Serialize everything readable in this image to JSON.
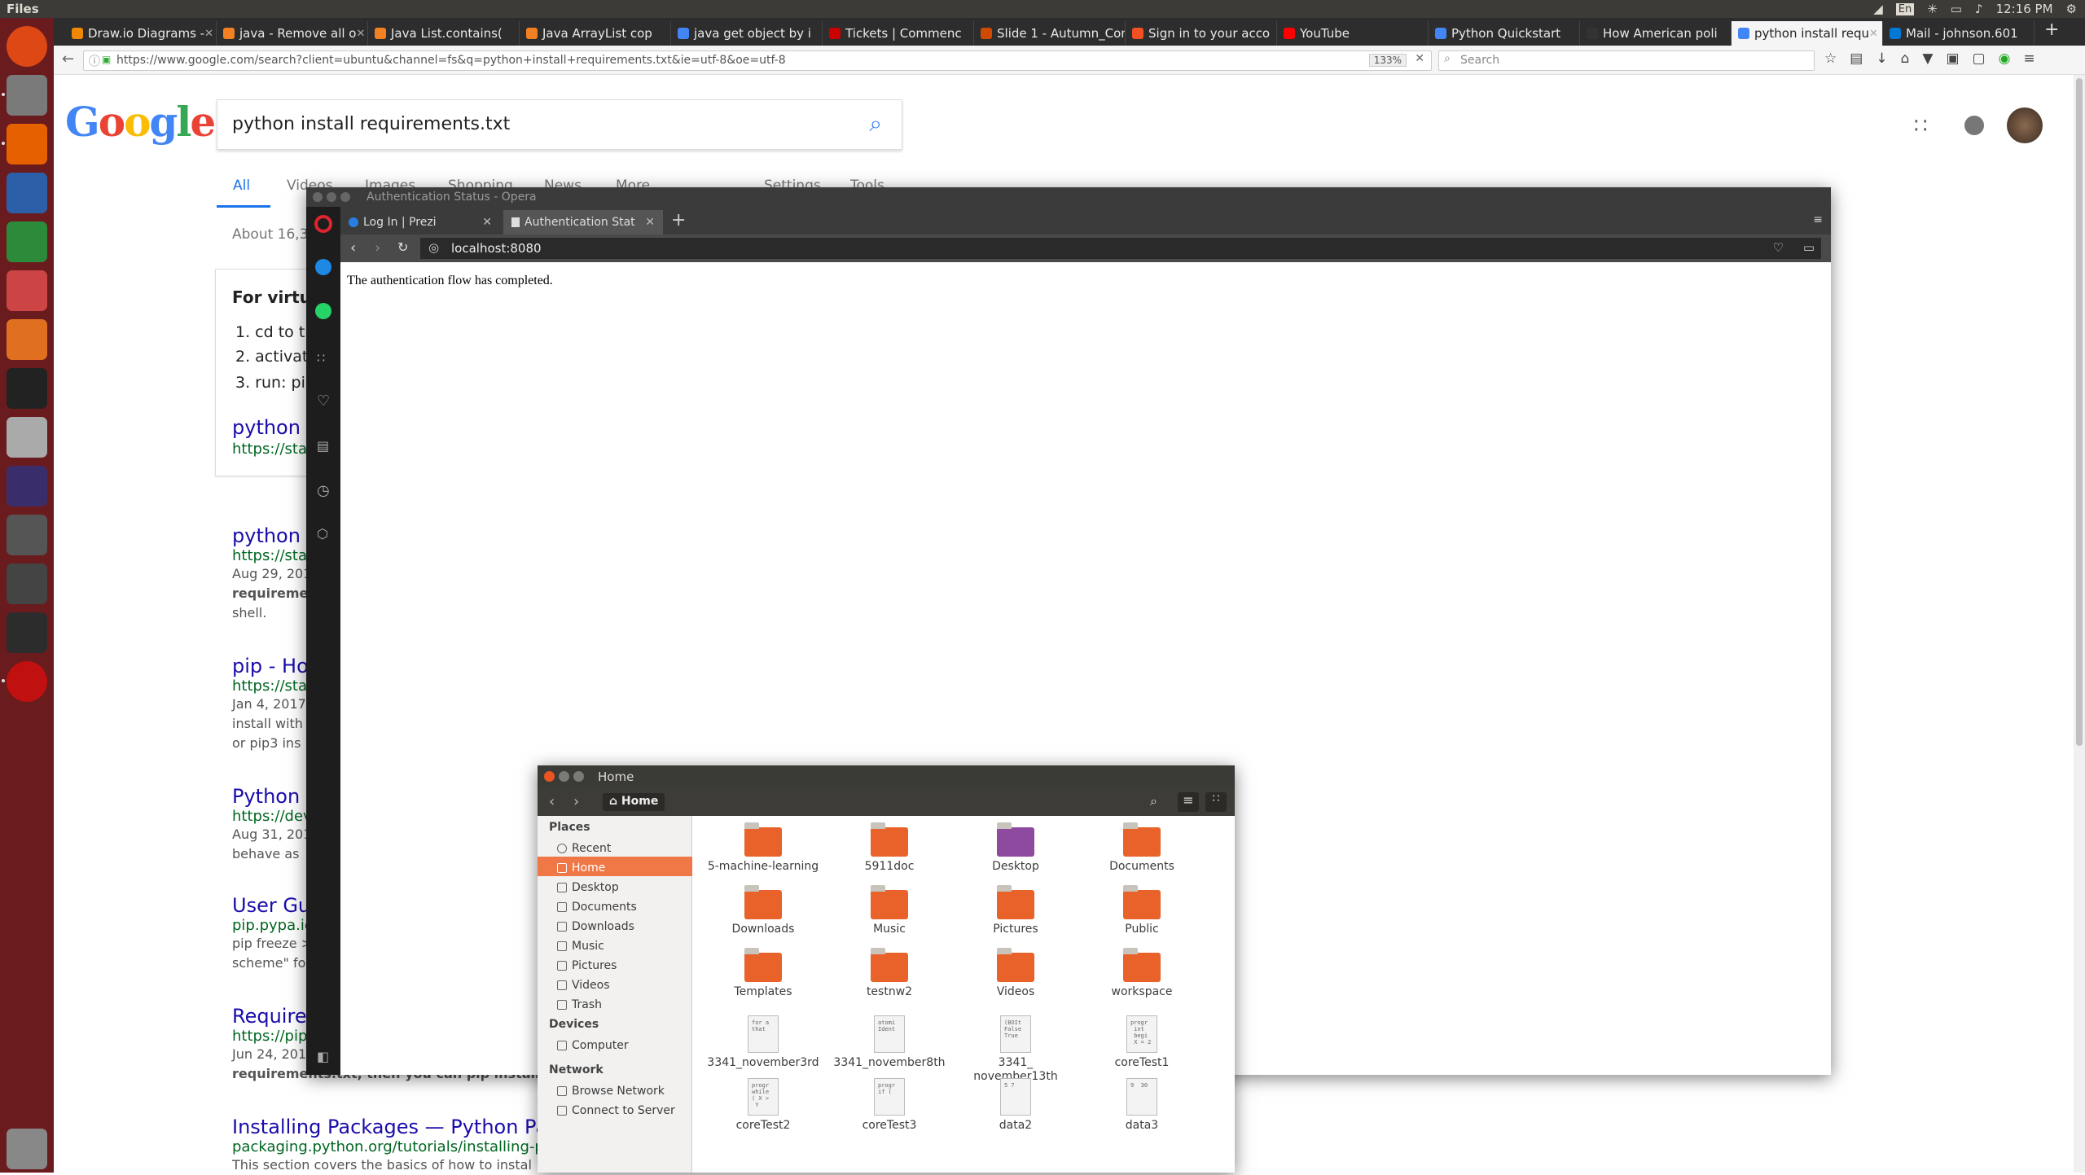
{
  "topbar": {
    "app_name": "Files",
    "time": "12:16 PM",
    "lang": "En"
  },
  "launcher": [
    "Ubuntu Dash",
    "Files",
    "Firefox",
    "LibreOffice Writer",
    "LibreOffice Calc",
    "LibreOffice Impress",
    "Ubuntu Software",
    "Amazon",
    "System Settings",
    "Eclipse",
    "Software Updater",
    "Sublime Text",
    "Terminal",
    "Opera",
    "Trash"
  ],
  "firefox": {
    "tabs": [
      "Draw.io Diagrams -",
      "java - Remove all o",
      "Java List.contains(",
      "Java ArrayList cop",
      "java get object by i",
      "Tickets | Commenc",
      "Slide 1 - Autumn_Com",
      "Sign in to your acco",
      "YouTube",
      "Python Quickstart",
      "How American poli",
      "python install requ",
      "Mail - johnson.601"
    ],
    "url": "https://www.google.com/search?client=ubuntu&channel=fs&q=python+install+requirements.txt&ie=utf-8&oe=utf-8",
    "zoom": "133%",
    "search_placeholder": "Search"
  },
  "google": {
    "logo": "Google",
    "query": "python install requirements.txt",
    "tabs": [
      "All",
      "Videos",
      "Images",
      "Shopping",
      "News",
      "More",
      "Settings",
      "Tools"
    ],
    "stats": "About 16,30",
    "snippet": {
      "heading": "For virtua",
      "steps": [
        "1. cd to th",
        "2. activat",
        "3. run: pi"
      ],
      "link": "python -",
      "url": "https://stack"
    },
    "results": [
      {
        "title": "python -",
        "url": "https://stack",
        "date": "Aug 29, 201",
        "text1": "requireme",
        "text2": "shell."
      },
      {
        "title": "pip - How",
        "url": "https://stack",
        "date": "Jan 4, 2017",
        "text1": "install with",
        "text2": "or pip3 ins"
      },
      {
        "title": "Python D",
        "url": "https://devo",
        "date": "Aug 31, 201",
        "text1": "behave as",
        "text2": ""
      },
      {
        "title": "User Gu",
        "url": "pip.pypa.io/",
        "date": "pip freeze >",
        "text1": "scheme\" fo",
        "text2": ""
      },
      {
        "title": "Requirem",
        "url": "https://pip.r",
        "date": "Jun 24, 201",
        "text1": "requirements.txt, then you can pip install -r re",
        "text2": ""
      },
      {
        "title": "Installing Packages — Python Pack",
        "url": "packaging.python.org/tutorials/installing-packag",
        "date": "This section covers the basics of how to instal",
        "text1": "",
        "text2": ""
      }
    ]
  },
  "opera": {
    "title": "Authentication Status - Opera",
    "tabs": [
      "Log In | Prezi",
      "Authentication Stat"
    ],
    "address": "localhost:8080",
    "body_text": "The authentication flow has completed."
  },
  "files": {
    "title": "Home",
    "breadcrumb": "Home",
    "sidebar": {
      "places_label": "Places",
      "places": [
        "Recent",
        "Home",
        "Desktop",
        "Documents",
        "Downloads",
        "Music",
        "Pictures",
        "Videos",
        "Trash"
      ],
      "devices_label": "Devices",
      "devices": [
        "Computer"
      ],
      "network_label": "Network",
      "network": [
        "Browse Network",
        "Connect to Server"
      ]
    },
    "items": [
      {
        "name": "5-machine-learning",
        "kind": "folder",
        "color": "#e8622a"
      },
      {
        "name": "5911doc",
        "kind": "folder",
        "color": "#e8622a"
      },
      {
        "name": "Desktop",
        "kind": "folder",
        "color": "#8e4a9f"
      },
      {
        "name": "Documents",
        "kind": "folder",
        "color": "#e8622a"
      },
      {
        "name": "Downloads",
        "kind": "folder",
        "color": "#e8622a"
      },
      {
        "name": "Music",
        "kind": "folder",
        "color": "#e8622a"
      },
      {
        "name": "Pictures",
        "kind": "folder",
        "color": "#e8622a"
      },
      {
        "name": "Public",
        "kind": "folder",
        "color": "#e8622a"
      },
      {
        "name": "Templates",
        "kind": "folder",
        "color": "#e8622a"
      },
      {
        "name": "testnw2",
        "kind": "folder",
        "color": "#e8622a"
      },
      {
        "name": "Videos",
        "kind": "folder",
        "color": "#e8622a"
      },
      {
        "name": "workspace",
        "kind": "folder",
        "color": "#e8622a"
      },
      {
        "name": "3341_november3rd",
        "kind": "doc",
        "preview": "for a\nthat"
      },
      {
        "name": "3341_november8th",
        "kind": "doc",
        "preview": "atomi\nIdent"
      },
      {
        "name": "3341_november13th",
        "kind": "doc",
        "preview": "(BOIt\nFalse\nTrue"
      },
      {
        "name": "coreTest1",
        "kind": "doc",
        "preview": "progr\n int\n begi\n X = 2"
      },
      {
        "name": "coreTest2",
        "kind": "doc",
        "preview": "progr\nwhile\n( X >\n Y"
      },
      {
        "name": "coreTest3",
        "kind": "doc",
        "preview": "progr\nif ("
      },
      {
        "name": "data2",
        "kind": "doc",
        "preview": "5 7"
      },
      {
        "name": "data3",
        "kind": "doc",
        "preview": "9  30"
      }
    ]
  }
}
